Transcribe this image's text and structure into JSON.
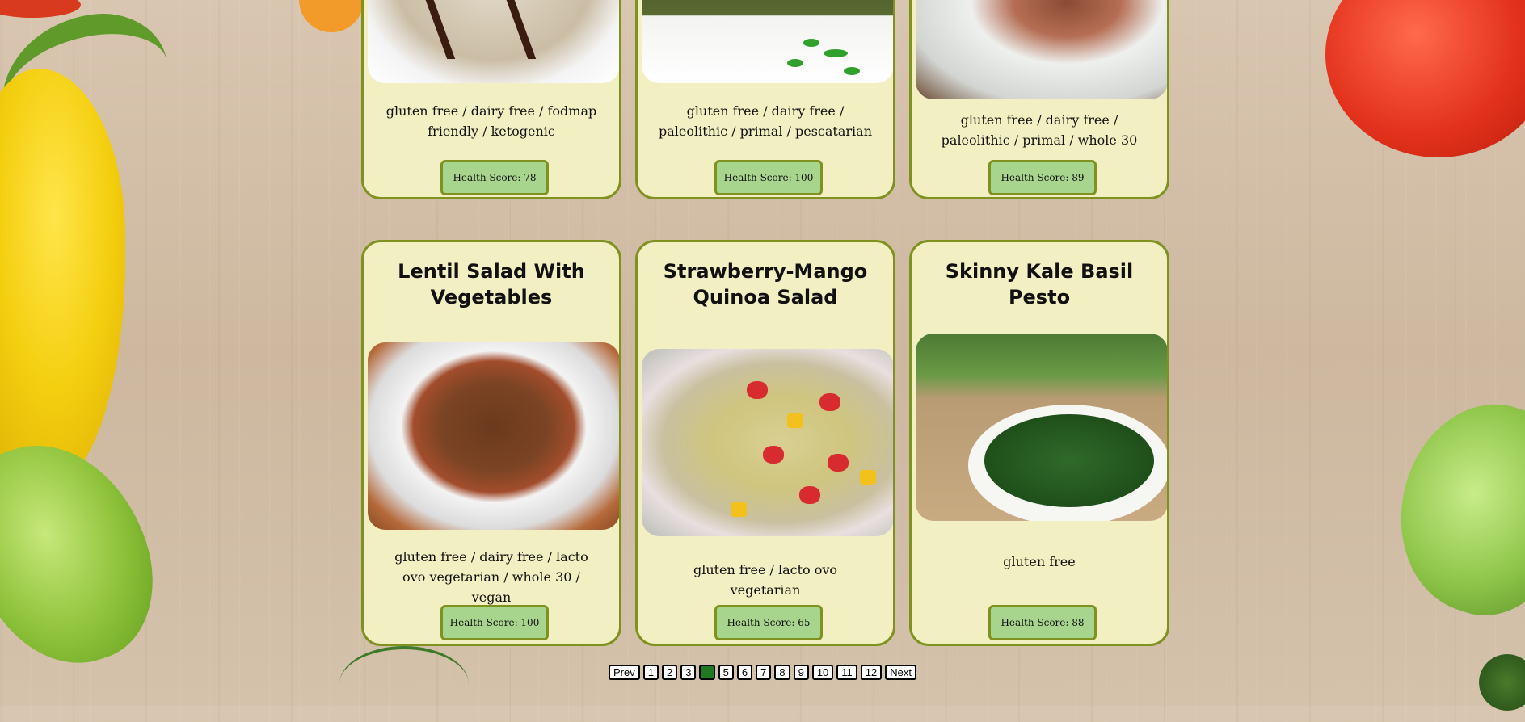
{
  "colors": {
    "card_background": "#f2f0c2",
    "card_border": "#7f9220",
    "score_button_background": "#a8d58e",
    "active_page": "#1f7a1f"
  },
  "cards_top": [
    {
      "diets": "gluten free / dairy free / fodmap friendly / ketogenic",
      "score_label": "Health Score: 78"
    },
    {
      "diets": "gluten free / dairy free / paleolithic / primal / pescatarian",
      "score_label": "Health Score: 100"
    },
    {
      "diets": "gluten free / dairy free / paleolithic / primal / whole 30",
      "score_label": "Health Score: 89"
    }
  ],
  "cards_bottom": [
    {
      "title": "Lentil Salad With Vegetables",
      "diets": "gluten free / dairy free / lacto ovo vegetarian / whole 30 / vegan",
      "score_label": "Health Score: 100"
    },
    {
      "title": "Strawberry-Mango Quinoa Salad",
      "diets": "gluten free / lacto ovo vegetarian",
      "score_label": "Health Score: 65"
    },
    {
      "title": "Skinny Kale Basil Pesto",
      "diets": "gluten free",
      "score_label": "Health Score: 88"
    }
  ],
  "pagination": {
    "prev_label": "Prev",
    "next_label": "Next",
    "pages": [
      "1",
      "2",
      "3",
      "4",
      "5",
      "6",
      "7",
      "8",
      "9",
      "10",
      "11",
      "12"
    ],
    "current_page": "4"
  }
}
